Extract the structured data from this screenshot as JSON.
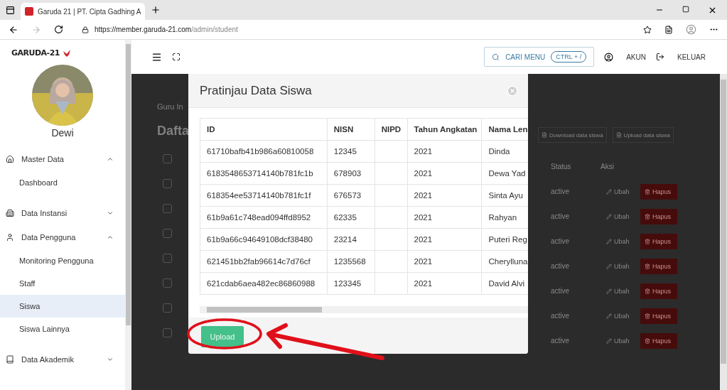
{
  "browser": {
    "tab": {
      "title": "Garuda 21 | PT. Cipta Gadhing A",
      "selected": true
    },
    "url_host": "https://member.garuda-21.com",
    "url_path": "/admin/student"
  },
  "sidebar": {
    "logo": "GARUDA-21",
    "user": "Dewi",
    "items": [
      {
        "label": "Master Data",
        "kind": "home",
        "expanded": true,
        "selected": false,
        "children": [
          {
            "label": "Dashboard",
            "selected": false
          }
        ]
      },
      {
        "label": "Data Instansi",
        "kind": "building",
        "expanded": false,
        "selected": false
      },
      {
        "label": "Data Pengguna",
        "kind": "user",
        "expanded": true,
        "selected": false,
        "children": [
          {
            "label": "Monitoring Pengguna",
            "selected": false
          },
          {
            "label": "Staff",
            "selected": false
          },
          {
            "label": "Siswa",
            "selected": true
          },
          {
            "label": "Siswa Lainnya",
            "selected": false
          }
        ]
      },
      {
        "label": "Data Akademik",
        "kind": "book",
        "expanded": false,
        "selected": false
      }
    ]
  },
  "header": {
    "search": "CARI MENU",
    "shortcut": "CTRL + /",
    "account": "AKUN",
    "logout": "KELUAR"
  },
  "page": {
    "breadcrumb": "Guru In",
    "heading": "Dafta",
    "buttons": [
      "Download data siswa",
      "Upload data siswa"
    ],
    "all_checked": false,
    "columns": [
      "Status",
      "Aksi"
    ],
    "rows": [
      {
        "checked": false,
        "status": "active",
        "edit": "Ubah",
        "delete": "Hapus"
      },
      {
        "checked": false,
        "status": "active",
        "edit": "Ubah",
        "delete": "Hapus"
      },
      {
        "checked": false,
        "status": "active",
        "edit": "Ubah",
        "delete": "Hapus"
      },
      {
        "checked": false,
        "status": "active",
        "edit": "Ubah",
        "delete": "Hapus"
      },
      {
        "checked": false,
        "status": "active",
        "edit": "Ubah",
        "delete": "Hapus"
      },
      {
        "checked": false,
        "status": "active",
        "edit": "Ubah",
        "delete": "Hapus"
      },
      {
        "checked": false,
        "status": "active",
        "edit": "Ubah",
        "delete": "Hapus"
      }
    ]
  },
  "modal": {
    "title": "Pratinjau Data Siswa",
    "columns": [
      "ID",
      "NISN",
      "NIPD",
      "Tahun Angkatan",
      "Nama Len"
    ],
    "rows": [
      [
        "61710bafb41b986a60810058",
        "12345",
        "",
        "2021",
        "Dinda"
      ],
      [
        "6183548653714140b781fc1b",
        "678903",
        "",
        "2021",
        "Dewa Yad"
      ],
      [
        "618354ee53714140b781fc1f",
        "676573",
        "",
        "2021",
        "Sinta Ayu"
      ],
      [
        "61b9a61c748ead094ffd8952",
        "62335",
        "",
        "2021",
        "Rahyan"
      ],
      [
        "61b9a66c94649108dcf38480",
        "23214",
        "",
        "2021",
        "Puteri Reg"
      ],
      [
        "621451bb2fab96614c7d76cf",
        "1235568",
        "",
        "2021",
        "Cherylluna"
      ],
      [
        "621cdab6aea482ec86860988",
        "123345",
        "",
        "2021",
        "David Alvi"
      ]
    ],
    "button": "Upload"
  }
}
